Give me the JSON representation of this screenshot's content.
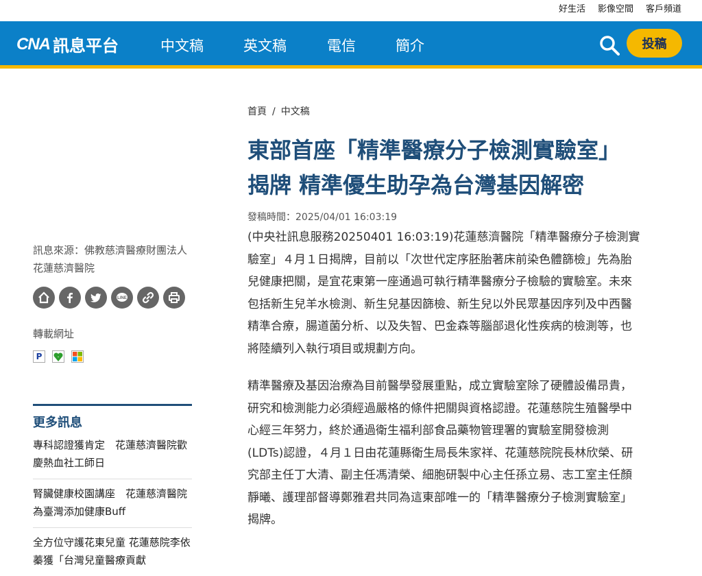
{
  "toplinks": [
    "好生活",
    "影像空間",
    "客戶頻道"
  ],
  "logo": {
    "mark": "CNA",
    "text": "訊息平台"
  },
  "nav": [
    "中文稿",
    "英文稿",
    "電信",
    "簡介"
  ],
  "submit_label": "投稿",
  "breadcrumb": {
    "home": "首頁",
    "sep": "/",
    "current": "中文稿"
  },
  "article": {
    "title": "東部首座「精準醫療分子檢測實驗室」揭牌 精準優生助孕為台灣基因解密",
    "time": "發稿時間：2025/04/01 16:03:19",
    "paragraphs": [
      "(中央社訊息服務20250401 16:03:19)花蓮慈濟醫院「精準醫療分子檢測實驗室」４月１日揭牌，目前以「次世代定序胚胎著床前染色體篩檢」先為胎兒健康把關，是宜花東第一座通過可執行精準醫療分子檢驗的實驗室。未來包括新生兒羊水檢測、新生兒基因篩檢、新生兒以外民眾基因序列及中西醫精準合療，腸道菌分析、以及失智、巴金森等腦部退化性疾病的檢測等，也將陸續列入執行項目或規劃方向。",
      "精準醫療及基因治療為目前醫學發展重點，成立實驗室除了硬體設備昂貴，研究和檢測能力必須經過嚴格的條件把關與資格認證。花蓮慈院生殖醫學中心經三年努力，終於通過衛生福利部食品藥物管理署的實驗室開發檢測(LDTs)認證，４月１日由花蓮縣衛生局長朱家祥、花蓮慈院院長林欣榮、研究部主任丁大清、副主任馮清榮、細胞研製中心主任孫立易、志工室主任顏靜曦、護理部督導鄭雅君共同為這東部唯一的「精準醫療分子檢測實驗室」揭牌。"
    ]
  },
  "sidebar": {
    "source": "訊息來源：佛教慈濟醫療財團法人花蓮慈濟醫院",
    "share_icons": [
      "home-icon",
      "facebook-icon",
      "twitter-icon",
      "line-icon",
      "link-icon",
      "print-icon"
    ],
    "line_text": "LINE",
    "repost_label": "轉載網址",
    "repost_icons": [
      "P",
      "",
      ""
    ],
    "more_title": "更多訊息",
    "more_items": [
      "專科認證獲肯定　花蓮慈濟醫院歡慶熱血社工師日",
      "腎臟健康校園講座　花蓮慈濟醫院為臺灣添加健康Buff",
      "全方位守護花東兒童 花蓮慈院李依蓁獲「台灣兒童醫療貢獻"
    ]
  },
  "colors": {
    "nav": "#0b80c8",
    "accent": "#f5b800",
    "title": "#1f4e79"
  }
}
